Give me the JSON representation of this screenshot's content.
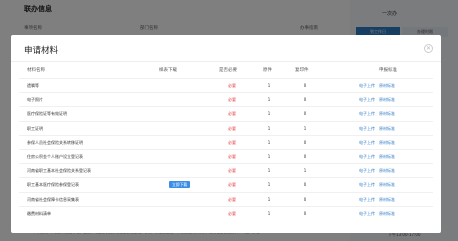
{
  "background": {
    "section_title": "联办信息",
    "columns": [
      "事项名称",
      "部门名称",
      "办事指南"
    ],
    "right_title": "一次办",
    "right_tabs": [
      "到工作日",
      "办理时限"
    ],
    "footer_text": "个体工商户、农民专业合作社、企业，为企业职工办理社会保险登记、参保人员信息登记，养老保险关系转移，缴纳社会保险费和个人账户办理",
    "office_hours": "下午13:00-17:00"
  },
  "modal": {
    "title": "申请材料",
    "close_icon": "close-icon",
    "headers": {
      "name": "材料名称",
      "sample": "样表下载",
      "required": "是否必要",
      "original": "原件",
      "copy": "复印件",
      "action": "申报标准"
    },
    "download_label": "立即下载",
    "upload_label": "电子上传",
    "standard_label": "原材标准",
    "rows": [
      {
        "name": "遗嘱等",
        "required": "必要",
        "original": "1",
        "copy": "0",
        "has_download": false
      },
      {
        "name": "电子照片",
        "required": "必要",
        "original": "1",
        "copy": "0",
        "has_download": false
      },
      {
        "name": "医疗保险证等有效证明",
        "required": "必要",
        "original": "1",
        "copy": "0",
        "has_download": false
      },
      {
        "name": "职工证明",
        "required": "必要",
        "original": "1",
        "copy": "1",
        "has_download": false
      },
      {
        "name": "参保人员社会保险关系转移证明",
        "required": "必要",
        "original": "1",
        "copy": "0",
        "has_download": false
      },
      {
        "name": "住房公积金个人账户设立登记表",
        "required": "必要",
        "original": "1",
        "copy": "0",
        "has_download": false
      },
      {
        "name": "河南省职工基本社会保险关系登记表",
        "required": "必要",
        "original": "1",
        "copy": "1",
        "has_download": false
      },
      {
        "name": "职工基本医疗保险参保登记表",
        "required": "必要",
        "original": "1",
        "copy": "0",
        "has_download": true
      },
      {
        "name": "河南省社会保障卡信息采集表",
        "required": "必要",
        "original": "1",
        "copy": "0",
        "has_download": false
      },
      {
        "name": "缴费材料清单",
        "required": "必要",
        "original": "1",
        "copy": "0",
        "has_download": false
      }
    ]
  }
}
